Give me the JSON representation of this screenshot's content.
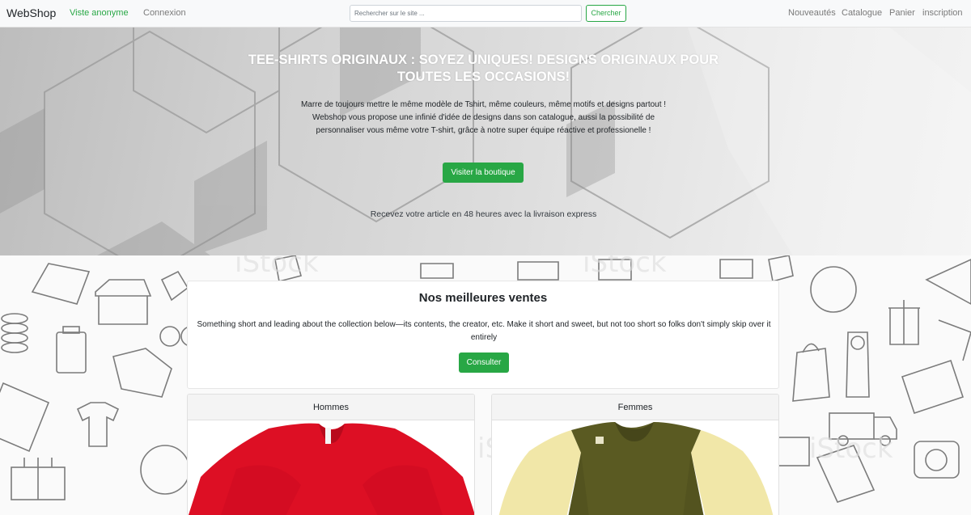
{
  "navbar": {
    "brand": "WebShop",
    "left_links": [
      "Viste anonyme",
      "Connexion"
    ],
    "search_placeholder": "Rechercher sur le site ...",
    "search_button": "Chercher",
    "right_links": [
      "Nouveautés",
      "Catalogue",
      "Panier",
      "inscription"
    ]
  },
  "hero": {
    "title": "TEE-SHIRTS ORIGINAUX : SOYEZ UNIQUES! DESIGNS ORIGINAUX POUR TOUTES LES OCCASIONS!",
    "description": "Marre de toujours mettre le même modèle de Tshirt, même couleurs, même motifs et designs partout ! Webshop vous propose une infinié d'idée de designs dans son catalogue, aussi la possibilité de personnaliser vous même votre T-shirt, grâce à notre super équipe réactive et professionelle !",
    "button": "Visiter la boutique",
    "note": "Recevez votre article en 48 heures avec la livraison express"
  },
  "best_sellers": {
    "title": "Nos meilleures ventes",
    "description": "Something short and leading about the collection below—its contents, the creator, etc. Make it short and sweet, but not too short so folks don't simply skip over it entirely",
    "button": "Consulter"
  },
  "products": [
    {
      "label": "Hommes"
    },
    {
      "label": "Femmes"
    }
  ],
  "colors": {
    "accent": "#28a745",
    "navbar_bg": "#f8f9fa",
    "tshirt_red": "#dd0f24",
    "tshirt_olive": "#5a5a22",
    "tshirt_cream": "#f1e7a8"
  }
}
